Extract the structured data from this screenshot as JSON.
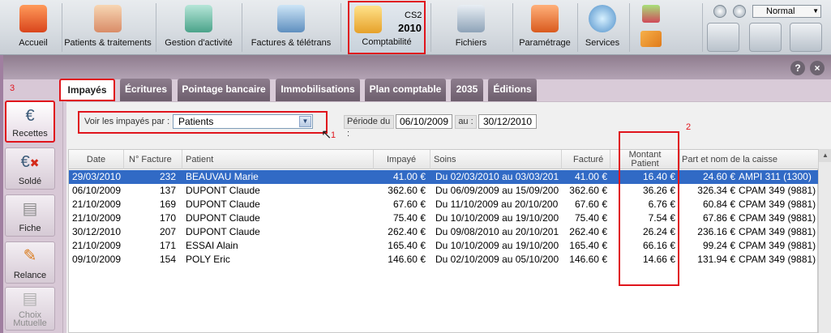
{
  "toolbar": {
    "items": [
      {
        "label": "Accueil"
      },
      {
        "label": "Patients & traitements"
      },
      {
        "label": "Gestion d'activité"
      },
      {
        "label": "Factures & télétrans"
      },
      {
        "label": "Comptabilité",
        "badge_top": "CS2",
        "badge_year": "2010"
      },
      {
        "label": "Fichiers"
      },
      {
        "label": "Paramétrage"
      },
      {
        "label": "Services"
      }
    ],
    "mode_value": "Normal"
  },
  "help": {
    "help_glyph": "?",
    "close_glyph": "×"
  },
  "sidebar": {
    "marker": "3",
    "items": [
      {
        "label": "Recettes",
        "icon": "euro-icon"
      },
      {
        "label": "Soldé",
        "icon": "euro-cross-icon"
      },
      {
        "label": "Fiche",
        "icon": "page-icon"
      },
      {
        "label": "Relance",
        "icon": "pencil-page-icon"
      },
      {
        "label": "Choix Mutuelle",
        "icon": "mutuelle-icon"
      }
    ]
  },
  "tabs": [
    {
      "label": "Impayés",
      "active": true
    },
    {
      "label": "Écritures"
    },
    {
      "label": "Pointage bancaire"
    },
    {
      "label": "Immobilisations"
    },
    {
      "label": "Plan comptable"
    },
    {
      "label": "2035"
    },
    {
      "label": "Éditions"
    }
  ],
  "filter": {
    "label": "Voir les impayés par :",
    "value": "Patients",
    "marker": "1",
    "periode_label": "Période du :",
    "date_from": "06/10/2009",
    "au_label": "au :",
    "date_to": "30/12/2010"
  },
  "annotation_2": "2",
  "table": {
    "headers": {
      "date": "Date",
      "num": "N° Facture",
      "patient": "Patient",
      "impaye": "Impayé",
      "soins": "Soins",
      "facture": "Facturé",
      "montant": "Montant Patient",
      "caisse": "Part et nom de la caisse"
    },
    "rows": [
      {
        "date": "29/03/2010",
        "num": "232",
        "patient": "BEAUVAU Marie",
        "impaye": "41.00 €",
        "soins": "Du 02/03/2010 au 03/03/201",
        "facture": "41.00 €",
        "montant": "16.40 €",
        "part": "24.60 €",
        "caisse": "AMPI 311 (1300)"
      },
      {
        "date": "06/10/2009",
        "num": "137",
        "patient": "DUPONT Claude",
        "impaye": "362.60 €",
        "soins": "Du 06/09/2009 au 15/09/200",
        "facture": "362.60 €",
        "montant": "36.26 €",
        "part": "326.34 €",
        "caisse": "CPAM 349 (9881)"
      },
      {
        "date": "21/10/2009",
        "num": "169",
        "patient": "DUPONT Claude",
        "impaye": "67.60 €",
        "soins": "Du 11/10/2009 au 20/10/200",
        "facture": "67.60 €",
        "montant": "6.76 €",
        "part": "60.84 €",
        "caisse": "CPAM 349 (9881)"
      },
      {
        "date": "21/10/2009",
        "num": "170",
        "patient": "DUPONT Claude",
        "impaye": "75.40 €",
        "soins": "Du 10/10/2009 au 19/10/200",
        "facture": "75.40 €",
        "montant": "7.54 €",
        "part": "67.86 €",
        "caisse": "CPAM 349 (9881)"
      },
      {
        "date": "30/12/2010",
        "num": "207",
        "patient": "DUPONT Claude",
        "impaye": "262.40 €",
        "soins": "Du 09/08/2010 au 20/10/201",
        "facture": "262.40 €",
        "montant": "26.24 €",
        "part": "236.16 €",
        "caisse": "CPAM 349 (9881)"
      },
      {
        "date": "21/10/2009",
        "num": "171",
        "patient": "ESSAI Alain",
        "impaye": "165.40 €",
        "soins": "Du 10/10/2009 au 19/10/200",
        "facture": "165.40 €",
        "montant": "66.16 €",
        "part": "99.24 €",
        "caisse": "CPAM 349 (9881)"
      },
      {
        "date": "09/10/2009",
        "num": "154",
        "patient": "POLY Eric",
        "impaye": "146.60 €",
        "soins": "Du 02/10/2009 au 05/10/200",
        "facture": "146.60 €",
        "montant": "14.66 €",
        "part": "131.94 €",
        "caisse": "CPAM 349 (9881)"
      }
    ]
  },
  "colors": {
    "accent_red": "#e0141c",
    "selection": "#316ac5",
    "tab_bg": "#7d6d7d",
    "band": "#a090a2"
  }
}
